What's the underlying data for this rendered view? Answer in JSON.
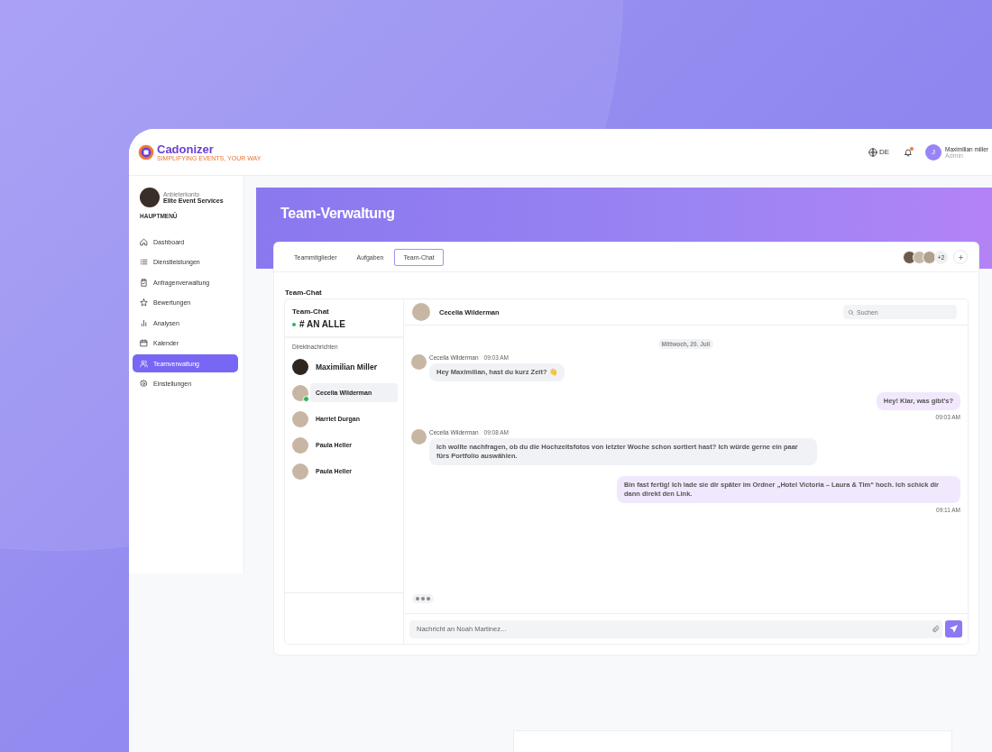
{
  "brand": {
    "name": "Cadonizer",
    "tagline": "SIMPLIFYING EVENTS, YOUR WAY"
  },
  "header": {
    "language": "DE",
    "notification_unread": true,
    "user": {
      "initial": "J",
      "name": "Maximilian miller",
      "role": "Admin"
    }
  },
  "sidebar": {
    "account_label": "Anbieterkonto",
    "account_name": "Elite Event Services",
    "section": "HAUPTMENÜ",
    "items": [
      {
        "label": "Dashboard",
        "selected": false
      },
      {
        "label": "Dienstleistungen",
        "selected": false
      },
      {
        "label": "Anfragenverwaltung",
        "selected": false
      },
      {
        "label": "Bewertungen",
        "selected": false
      },
      {
        "label": "Analysen",
        "selected": false
      },
      {
        "label": "Kalender",
        "selected": false
      },
      {
        "label": "Teamverwaltung",
        "selected": true
      },
      {
        "label": "Einstellungen",
        "selected": false
      }
    ]
  },
  "page": {
    "title": "Team-Verwaltung"
  },
  "tabs": [
    {
      "label": "Teammitglieder",
      "selected": false
    },
    {
      "label": "Aufgaben",
      "selected": false
    },
    {
      "label": "Team-Chat",
      "selected": true
    }
  ],
  "team_stack": {
    "more": "+2"
  },
  "chat": {
    "heading": "Team-Chat",
    "channels_title": "Team-Chat",
    "channel": "# AN ALLE",
    "dm_title": "Direktnachrichten",
    "contacts": [
      {
        "name": "Maximilian Miller",
        "emphasized": true,
        "selected": false,
        "online": false
      },
      {
        "name": "Cecelia Wilderman",
        "emphasized": false,
        "selected": true,
        "online": true
      },
      {
        "name": "Harriet Durgan",
        "emphasized": false,
        "selected": false,
        "online": false
      },
      {
        "name": "Paula Heller",
        "emphasized": false,
        "selected": false,
        "online": false
      },
      {
        "name": "Paula Heller",
        "emphasized": false,
        "selected": false,
        "online": false
      }
    ],
    "active_contact": "Cecelia Wilderman",
    "search_placeholder": "Suchen",
    "date": "Mittwoch, 20. Juli",
    "messages": [
      {
        "kind": "incoming",
        "sender": "Cecelia Wilderman",
        "time": "09:03 AM",
        "text": "Hey Maximilian, hast du kurz Zeit? 👋"
      },
      {
        "kind": "outgoing",
        "time": "09:03 AM",
        "text": "Hey! Klar, was gibt's?"
      },
      {
        "kind": "incoming",
        "sender": "Cecelia Wilderman",
        "time": "09:08 AM",
        "text": "Ich wollte nachfragen, ob du die Hochzeitsfotos von letzter Woche schon sortiert hast? Ich würde gerne ein paar fürs Portfolio auswählen."
      },
      {
        "kind": "outgoing",
        "time": "09:11 AM",
        "text": "Bin fast fertig! Ich lade sie dir später im Ordner „Hotel Victoria – Laura & Tim“ hoch. Ich schick dir dann direkt den Link."
      }
    ],
    "typing": true,
    "composer_placeholder": "Nachricht an Noah Martinez..."
  }
}
